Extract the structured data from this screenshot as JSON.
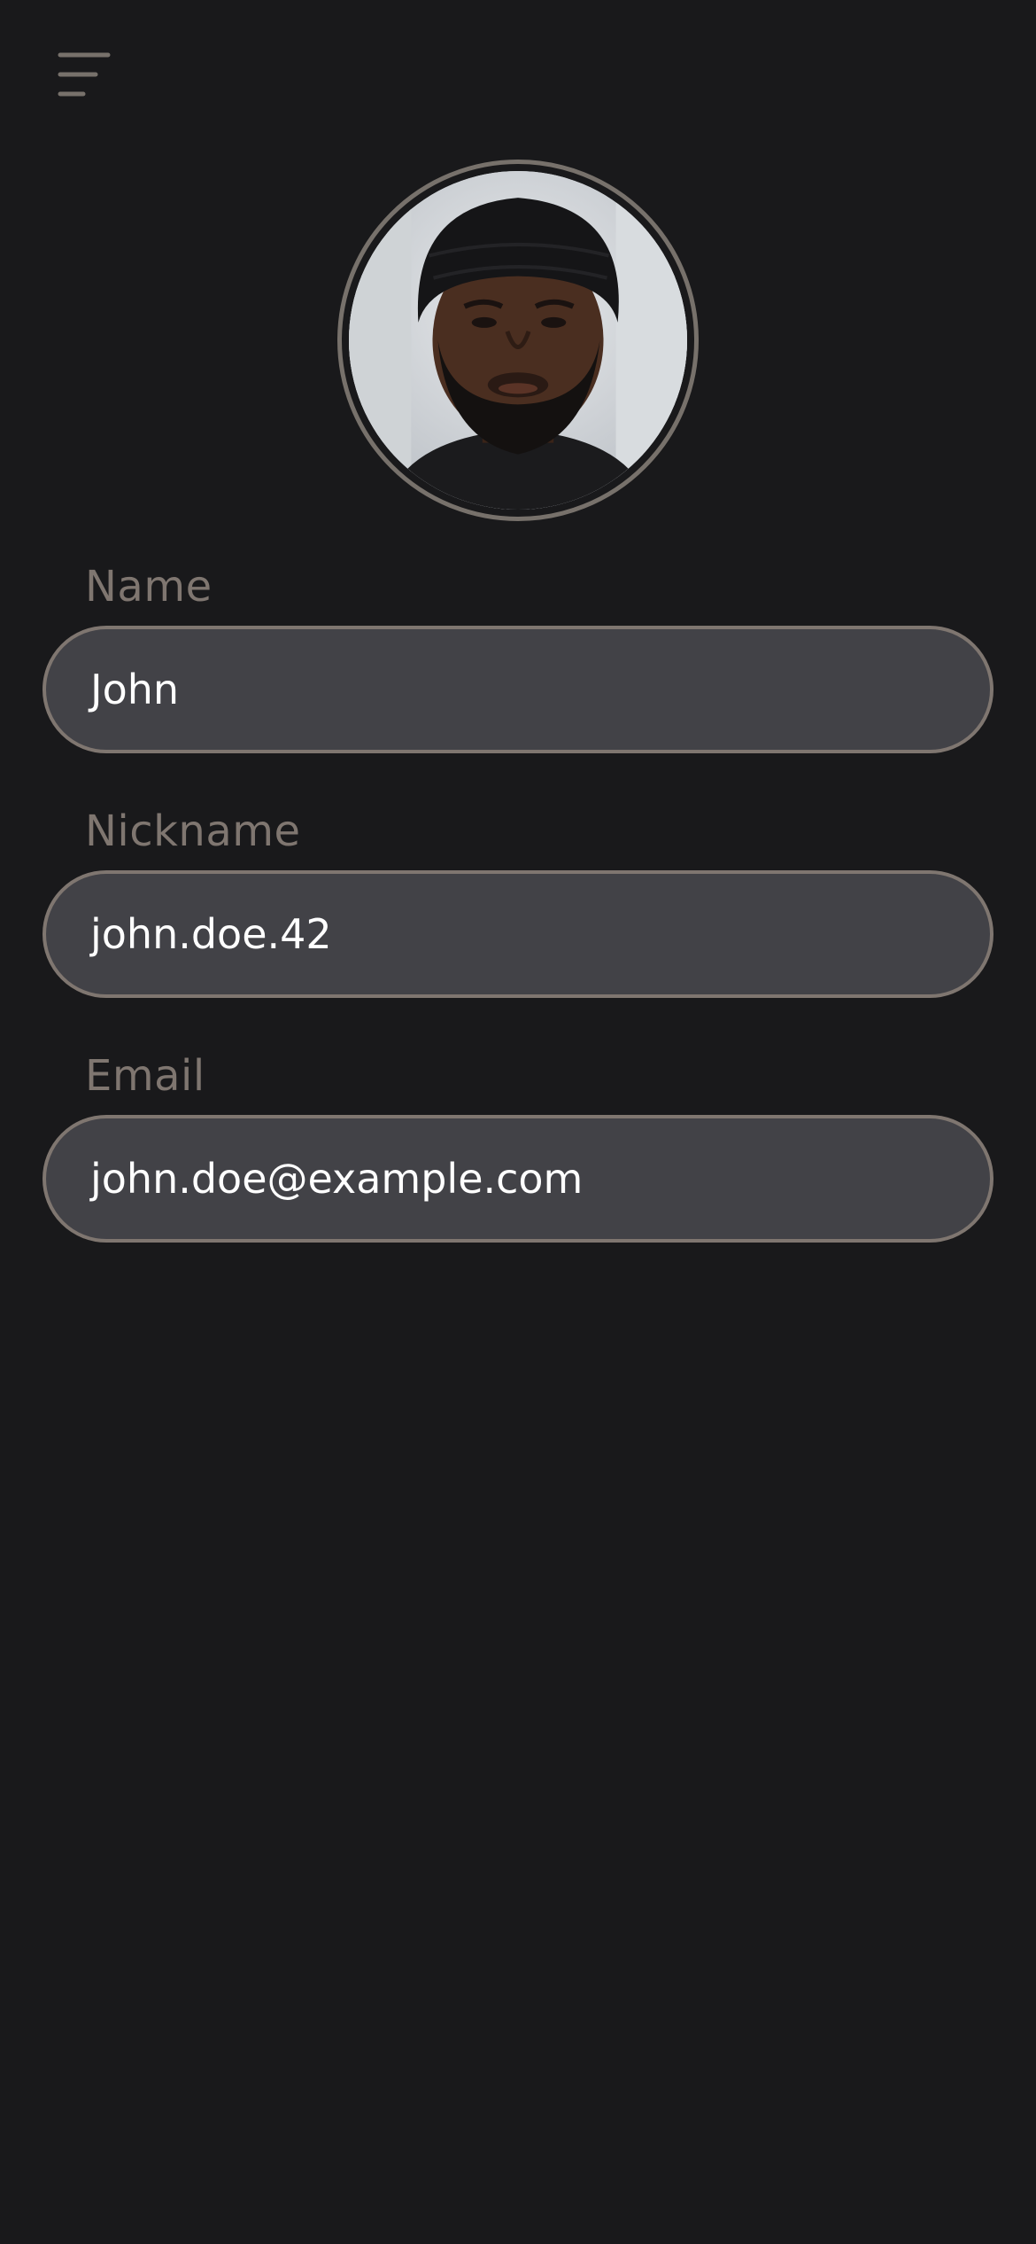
{
  "header": {
    "menu_icon": "hamburger-menu-icon"
  },
  "profile": {
    "avatar_icon": "user-avatar-photo"
  },
  "form": {
    "name": {
      "label": "Name",
      "value": "John"
    },
    "nickname": {
      "label": "Nickname",
      "value": "john.doe.42"
    },
    "email": {
      "label": "Email",
      "value": "john.doe@example.com"
    }
  },
  "colors": {
    "background": "#19191b",
    "field_background": "#424247",
    "border": "#7f7670",
    "label": "#7f7670",
    "value_text": "#ffffff"
  }
}
